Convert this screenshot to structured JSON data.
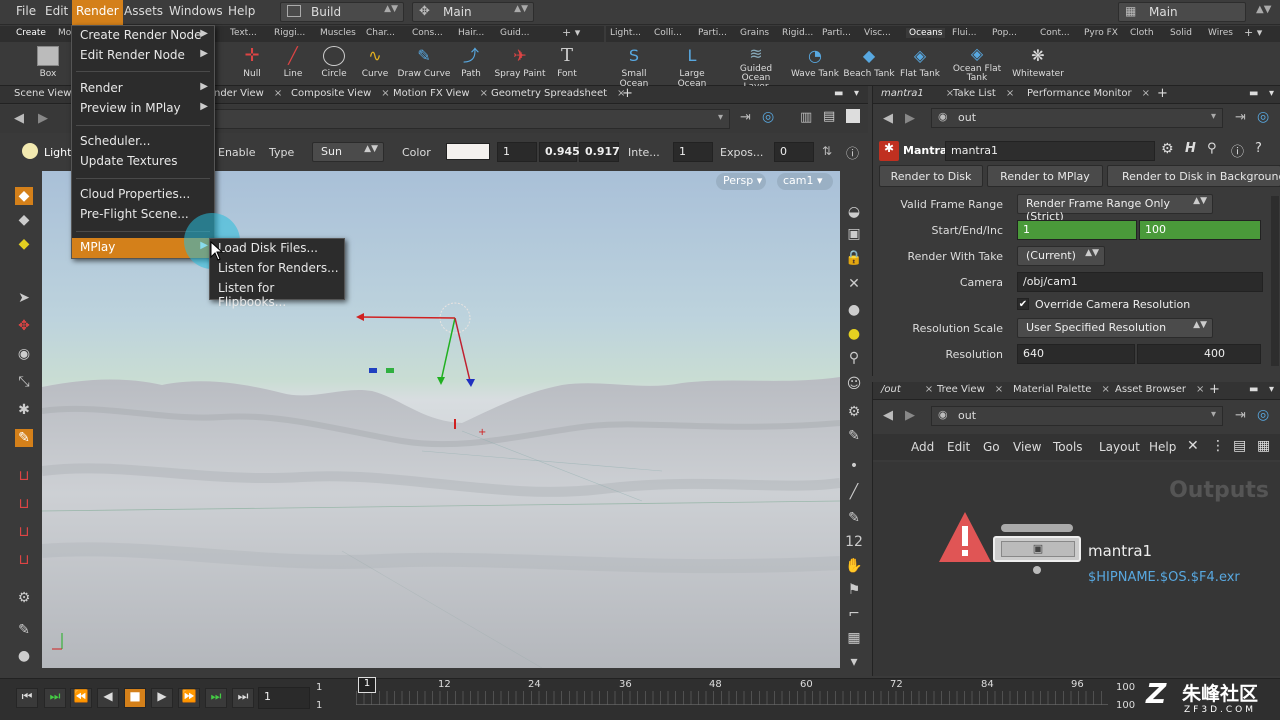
{
  "menubar": {
    "items": [
      "File",
      "Edit",
      "Render",
      "Assets",
      "Windows",
      "Help"
    ],
    "desktop": "Build",
    "context": "Main",
    "right_desktop": "Main"
  },
  "shelf": {
    "left_tabs": [
      "Create",
      "Mo",
      "Text...",
      "Riggi...",
      "Muscles",
      "Char...",
      "Cons...",
      "Hair...",
      "Guid..."
    ],
    "left_tools": [
      "Box",
      "Null",
      "Line",
      "Circle",
      "Curve",
      "Draw Curve",
      "Path",
      "Spray Paint",
      "Font"
    ],
    "right_tabs": [
      "Light...",
      "Colli...",
      "Parti...",
      "Grains",
      "Rigid...",
      "Parti...",
      "Visc...",
      "Oceans",
      "Flui...",
      "Pop...",
      "Cont...",
      "Pyro FX",
      "Cloth",
      "Solid",
      "Wires"
    ],
    "right_tools": [
      "Small Ocean",
      "Large Ocean",
      "Guided Ocean Layer",
      "Wave Tank",
      "Beach Tank",
      "Flat Tank",
      "Ocean Flat Tank",
      "Whitewater"
    ]
  },
  "left_panes": {
    "tabs": [
      "Scene View",
      "nder View",
      "Composite View",
      "Motion FX View",
      "Geometry Spreadsheet"
    ]
  },
  "light_toolbar": {
    "name": "Light",
    "enable": "Enable",
    "type_label": "Type",
    "type_value": "Sun",
    "color_label": "Color",
    "color_value": "1",
    "v2": "0.945",
    "v3": "0.917",
    "intensity_label": "Inte...",
    "intensity_value": "1",
    "exposure_label": "Expos...",
    "exposure_value": "0"
  },
  "viewport": {
    "persp": "Persp",
    "camera": "cam1"
  },
  "render_menu": {
    "items": [
      "Create Render Node",
      "Edit Render Node",
      "Render",
      "Preview in MPlay",
      "Scheduler...",
      "Update Textures",
      "Cloud Properties...",
      "Pre-Flight Scene...",
      "MPlay"
    ]
  },
  "mplay_submenu": {
    "items": [
      "Load Disk Files...",
      "Listen for Renders...",
      "Listen for Flipbooks..."
    ]
  },
  "right_top": {
    "tabs": [
      "mantra1",
      "Take List",
      "Performance Monitor"
    ],
    "path": "out",
    "node_type": "Mantra",
    "node_name": "mantra1",
    "buttons": [
      "Render to Disk",
      "Render to MPlay",
      "Render to Disk in Background"
    ],
    "params": {
      "valid_range_label": "Valid Frame Range",
      "valid_range_value": "Render Frame Range Only (Strict)",
      "start_end_label": "Start/End/Inc",
      "start": "1",
      "end": "100",
      "take_label": "Render With Take",
      "take_value": "(Current)",
      "camera_label": "Camera",
      "camera_value": "/obj/cam1",
      "override_label": "Override Camera Resolution",
      "res_scale_label": "Resolution Scale",
      "res_scale_value": "User Specified Resolution",
      "resolution_label": "Resolution",
      "res_x": "640",
      "res_y": "400"
    }
  },
  "right_bottom": {
    "tabs": [
      "/out",
      "Tree View",
      "Material Palette",
      "Asset Browser"
    ],
    "path": "out",
    "menu": [
      "Add",
      "Edit",
      "Go",
      "View",
      "Tools",
      "Layout",
      "Help"
    ],
    "context_title": "Outputs",
    "node_name": "mantra1",
    "node_output": "$HIPNAME.$OS.$F4.exr"
  },
  "playbar": {
    "frame": "1",
    "start1": "1",
    "start2": "1",
    "current": "1",
    "ticks": [
      "12",
      "24",
      "36",
      "48",
      "60",
      "72",
      "84",
      "96"
    ],
    "end1": "100",
    "end2": "100"
  },
  "watermark": {
    "text": "朱峰社区",
    "url": "ZF3D.COM"
  },
  "colors": {
    "accent": "#d4801a",
    "green_field": "#4a9a3a",
    "link": "#58a8e0",
    "warning": "#e05555"
  }
}
